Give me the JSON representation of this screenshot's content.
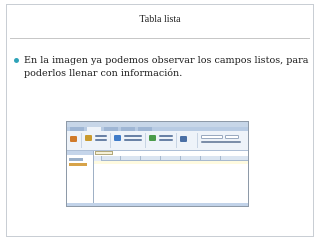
{
  "slide": {
    "title": "Tabla lista",
    "bullet_text": "En la imagen ya podemos observar los campos listos, para poderlos llenar con información."
  },
  "colors": {
    "bullet": "#2ea3b8",
    "screenshot_frame": "#8e9aa8",
    "ribbon": "#eef3f9"
  },
  "embedded_screenshot": {
    "icons": [
      "quick-access-icon",
      "ribbon-view-icon",
      "ribbon-paste-icon",
      "ribbon-filter-icon",
      "ribbon-records-icon",
      "ribbon-find-icon",
      "ribbon-format-icon"
    ]
  }
}
